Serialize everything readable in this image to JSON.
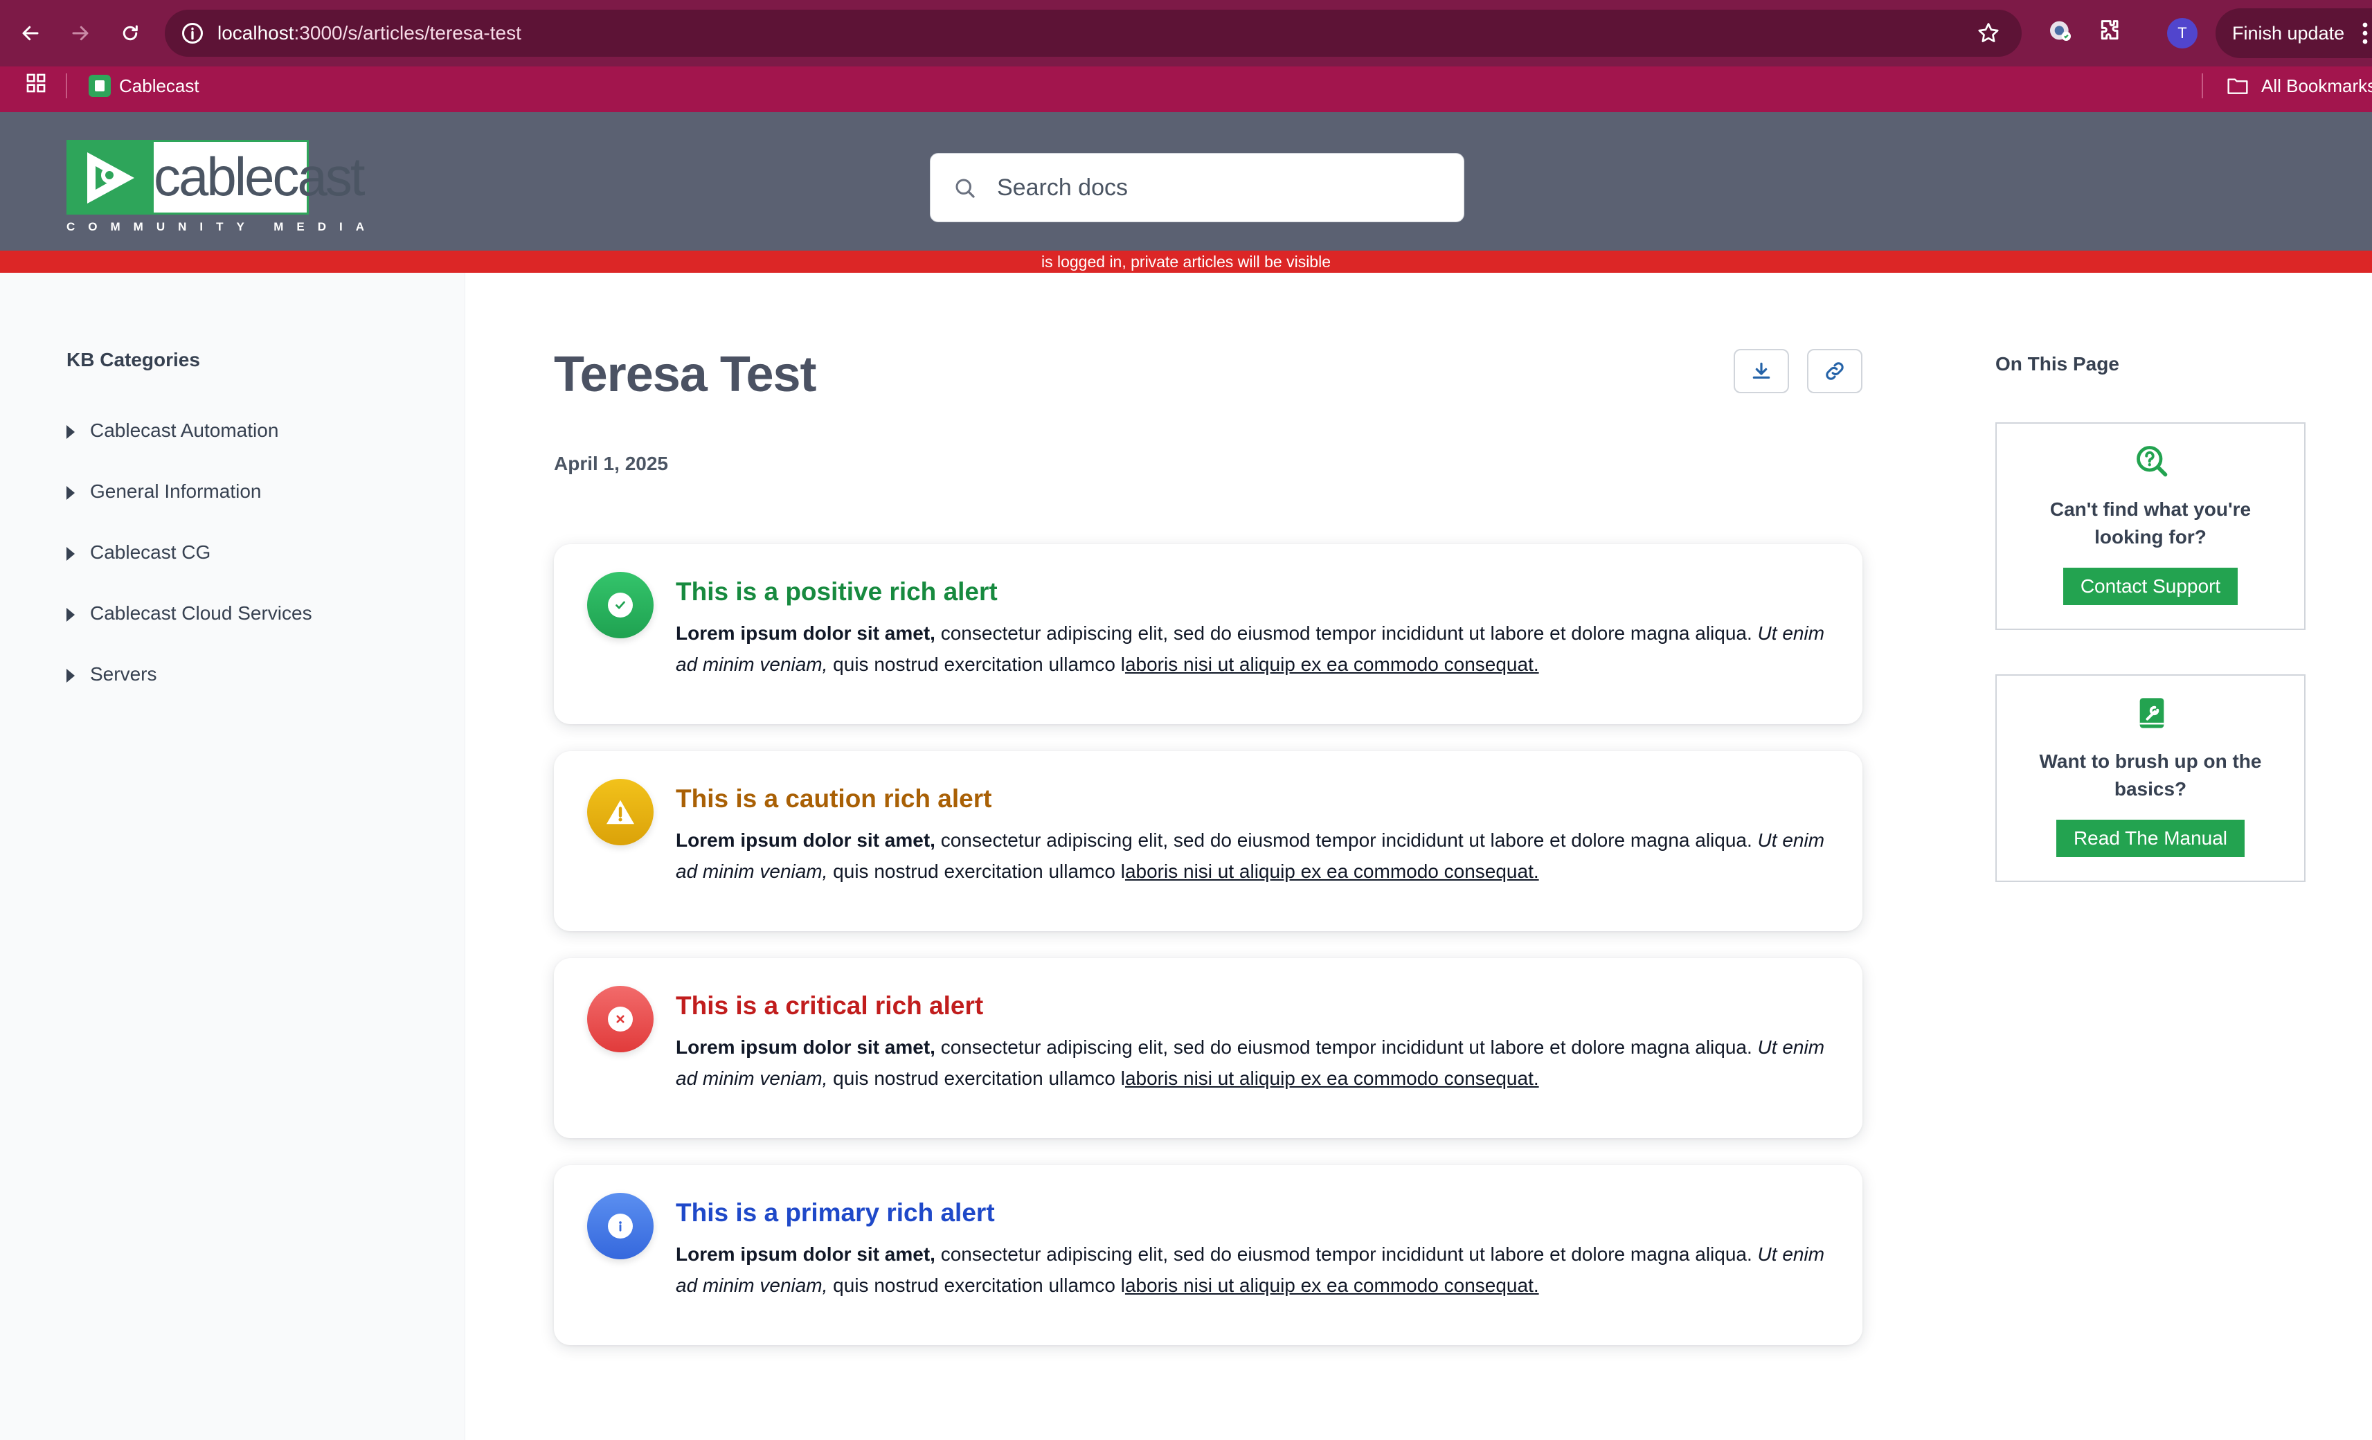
{
  "browser": {
    "url_host": "localhost",
    "url_path": ":3000/s/articles/teresa-test",
    "profile_initial": "T",
    "update_label": "Finish update",
    "bookmarks": [
      {
        "label": "Cablecast"
      }
    ],
    "all_bookmarks_label": "All Bookmarks",
    "theme_color": "#7d1a47"
  },
  "header": {
    "logo_word": "cablecast",
    "logo_tagline": "COMMUNITY MEDIA",
    "search_placeholder": "Search docs",
    "login_notice": "is logged in, private articles will be visible"
  },
  "sidebar": {
    "title": "KB Categories",
    "items": [
      {
        "label": "Cablecast Automation"
      },
      {
        "label": "General Information"
      },
      {
        "label": "Cablecast CG"
      },
      {
        "label": "Cablecast Cloud Services"
      },
      {
        "label": "Servers"
      }
    ]
  },
  "article": {
    "title": "Teresa Test",
    "date": "April 1, 2025",
    "alerts": [
      {
        "type": "positive",
        "color": "#178a3f",
        "icon": "check-icon",
        "title": "This is a positive rich alert",
        "bold": "Lorem ipsum dolor sit amet,",
        "text1": " consectetur adipiscing elit, sed do eiusmod tempor incididunt ut labore et dolore magna aliqua. ",
        "italic": "Ut enim ad minim veniam,",
        "text2": " quis nostrud exercitation ullamco l",
        "link": "aboris nisi ut aliquip ex ea commodo consequat."
      },
      {
        "type": "caution",
        "color": "#a96005",
        "icon": "warning-icon",
        "title": "This is a caution rich alert",
        "bold": "Lorem ipsum dolor sit amet,",
        "text1": " consectetur adipiscing elit, sed do eiusmod tempor incididunt ut labore et dolore magna aliqua. ",
        "italic": "Ut enim ad minim veniam,",
        "text2": " quis nostrud exercitation ullamco l",
        "link": "aboris nisi ut aliquip ex ea commodo consequat."
      },
      {
        "type": "critical",
        "color": "#c11d1d",
        "icon": "x-icon",
        "title": "This is a critical rich alert",
        "bold": "Lorem ipsum dolor sit amet,",
        "text1": " consectetur adipiscing elit, sed do eiusmod tempor incididunt ut labore et dolore magna aliqua. ",
        "italic": "Ut enim ad minim veniam,",
        "text2": " quis nostrud exercitation ullamco l",
        "link": "aboris nisi ut aliquip ex ea commodo consequat."
      },
      {
        "type": "primary",
        "color": "#1f49c9",
        "icon": "info-icon",
        "title": "This is a primary rich alert",
        "bold": "Lorem ipsum dolor sit amet,",
        "text1": " consectetur adipiscing elit, sed do eiusmod tempor incididunt ut labore et dolore magna aliqua. ",
        "italic": "Ut enim ad minim veniam,",
        "text2": " quis nostrud exercitation ullamco l",
        "link": "aboris nisi ut aliquip ex ea commodo consequat."
      }
    ]
  },
  "toc": {
    "title": "On This Page",
    "cards": [
      {
        "icon": "search-help-icon",
        "text": "Can't find what you're looking for?",
        "button": "Contact Support"
      },
      {
        "icon": "manual-book-icon",
        "text": "Want to brush up on the basics?",
        "button": "Read The Manual"
      }
    ]
  },
  "colors": {
    "header_bg": "#5b6172",
    "banner_red": "#dc2626",
    "brand_green": "#23a350"
  }
}
